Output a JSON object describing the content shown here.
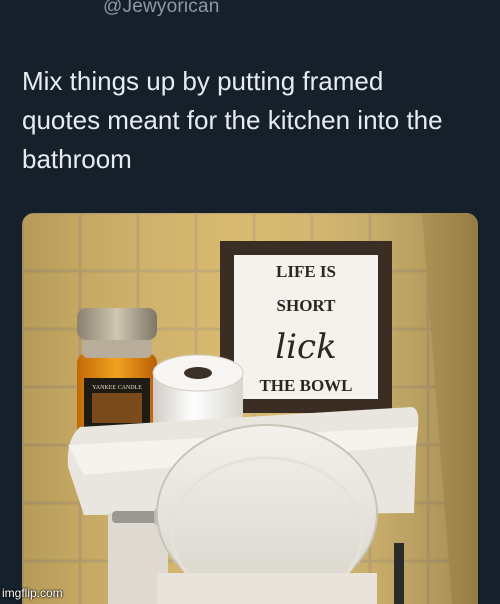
{
  "tweet": {
    "handle": "@Jewyorican",
    "text": "Mix things up by putting framed\nquotes meant for the kitchen into the\nbathroom"
  },
  "photo": {
    "sign_lines": [
      "LIFE IS",
      "SHORT",
      "lick",
      "THE BOWL"
    ],
    "candle_label": "YANKEE CANDLE",
    "colors": {
      "wall_tile": "#d2b163",
      "grout": "#c9b184",
      "frame": "#3a2d24",
      "toilet": "#e9e6df",
      "candle_wax": "#e2880f"
    }
  },
  "watermark": "imgflip.com"
}
